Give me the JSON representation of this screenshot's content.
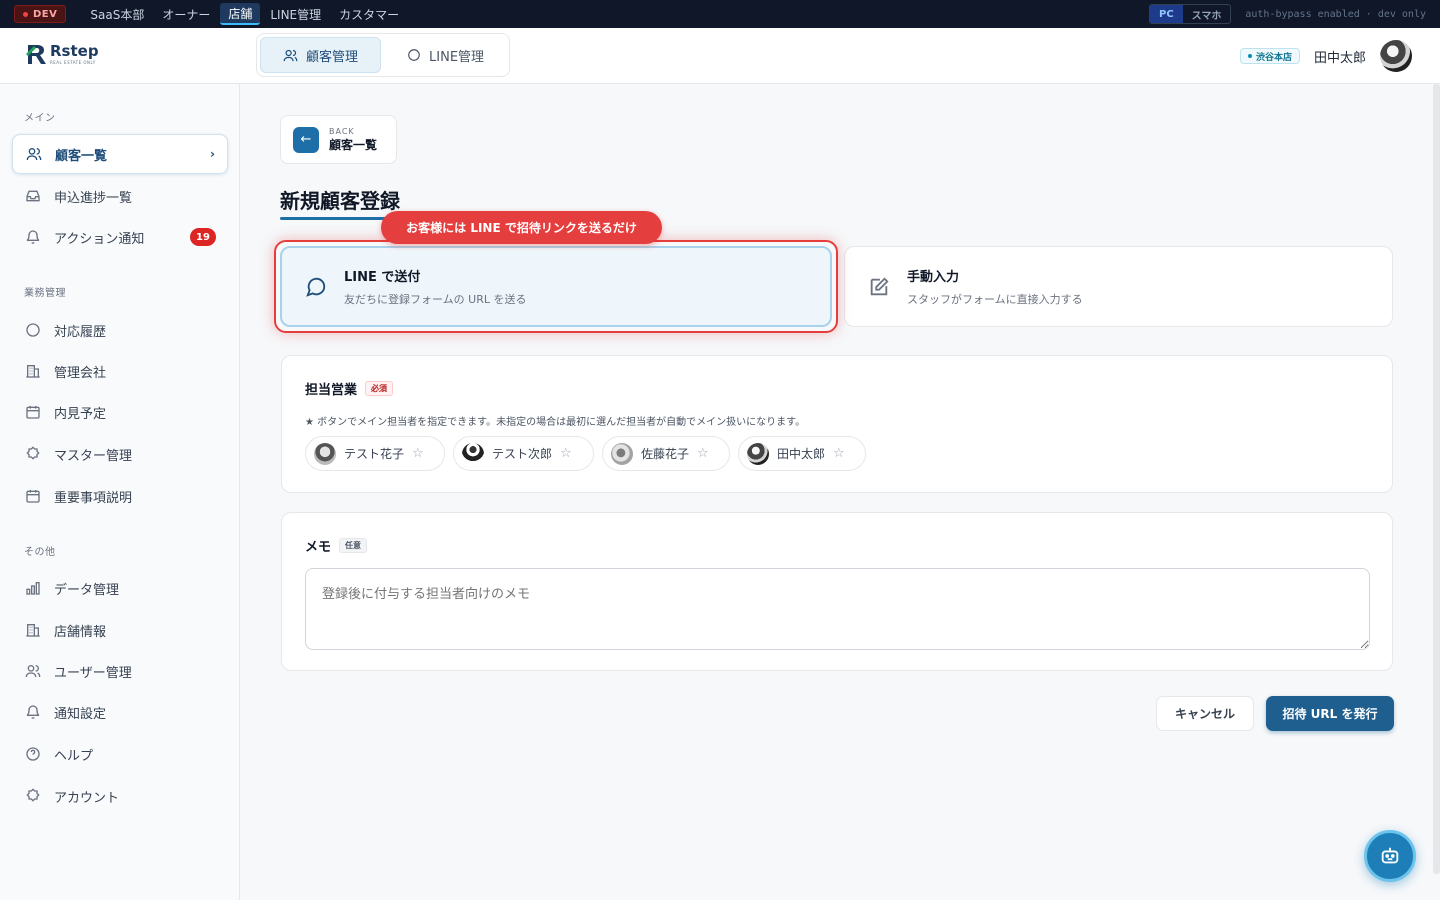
{
  "devbar": {
    "env_badge": "DEV",
    "nav": [
      "SaaS本部",
      "オーナー",
      "店舗",
      "LINE管理",
      "カスタマー"
    ],
    "device_options": [
      "PC",
      "スマホ"
    ],
    "note": "auth-bypass enabled · dev only"
  },
  "header": {
    "logo_text": "Rstep",
    "logo_sub": "REAL ESTATE ONLY",
    "tabs": [
      "顧客管理",
      "LINE管理"
    ],
    "store": "渋谷本店",
    "user_name": "田中太郎"
  },
  "sidebar": {
    "sections": [
      "メイン",
      "業務管理",
      "その他"
    ],
    "items": [
      {
        "label": "顧客一覧",
        "icon": "users-icon"
      },
      {
        "label": "申込進捗一覧",
        "icon": "inbox-icon"
      },
      {
        "label": "アクション通知",
        "icon": "bell-icon",
        "badge": "19"
      },
      {
        "label": "対応履歴",
        "icon": "chat-icon"
      },
      {
        "label": "管理会社",
        "icon": "building-icon"
      },
      {
        "label": "内見予定",
        "icon": "calendar-icon"
      },
      {
        "label": "マスター管理",
        "icon": "gear-icon"
      },
      {
        "label": "重要事項説明",
        "icon": "calendar-icon"
      },
      {
        "label": "データ管理",
        "icon": "bar-chart-icon"
      },
      {
        "label": "店舗情報",
        "icon": "building-icon"
      },
      {
        "label": "ユーザー管理",
        "icon": "users-icon"
      },
      {
        "label": "通知設定",
        "icon": "bell-icon"
      },
      {
        "label": "ヘルプ",
        "icon": "help-icon"
      },
      {
        "label": "アカウント",
        "icon": "gear-icon"
      }
    ]
  },
  "main": {
    "back_small": "BACK",
    "back_label": "顧客一覧",
    "title": "新規顧客登録",
    "tooltip": "お客様には LINE で招待リンクを送るだけ",
    "options": [
      {
        "title": "LINE で送付",
        "desc": "友だちに登録フォームの URL を送る"
      },
      {
        "title": "手動入力",
        "desc": "スタッフがフォームに直接入力する"
      }
    ],
    "sales": {
      "label": "担当営業",
      "required": "必須",
      "hint": "★ ボタンでメイン担当者を指定できます。未指定の場合は最初に選んだ担当者が自動でメイン扱いになります。",
      "people": [
        "テスト花子",
        "テスト次郎",
        "佐藤花子",
        "田中太郎"
      ]
    },
    "memo": {
      "label": "メモ",
      "optional": "任意",
      "placeholder": "登録後に付与する担当者向けのメモ"
    },
    "cancel": "キャンセル",
    "submit": "招待 URL を発行"
  },
  "colors": {
    "accent": "#1e5f8f",
    "highlight": "#e53e3e",
    "devbar": "#0f1729"
  }
}
